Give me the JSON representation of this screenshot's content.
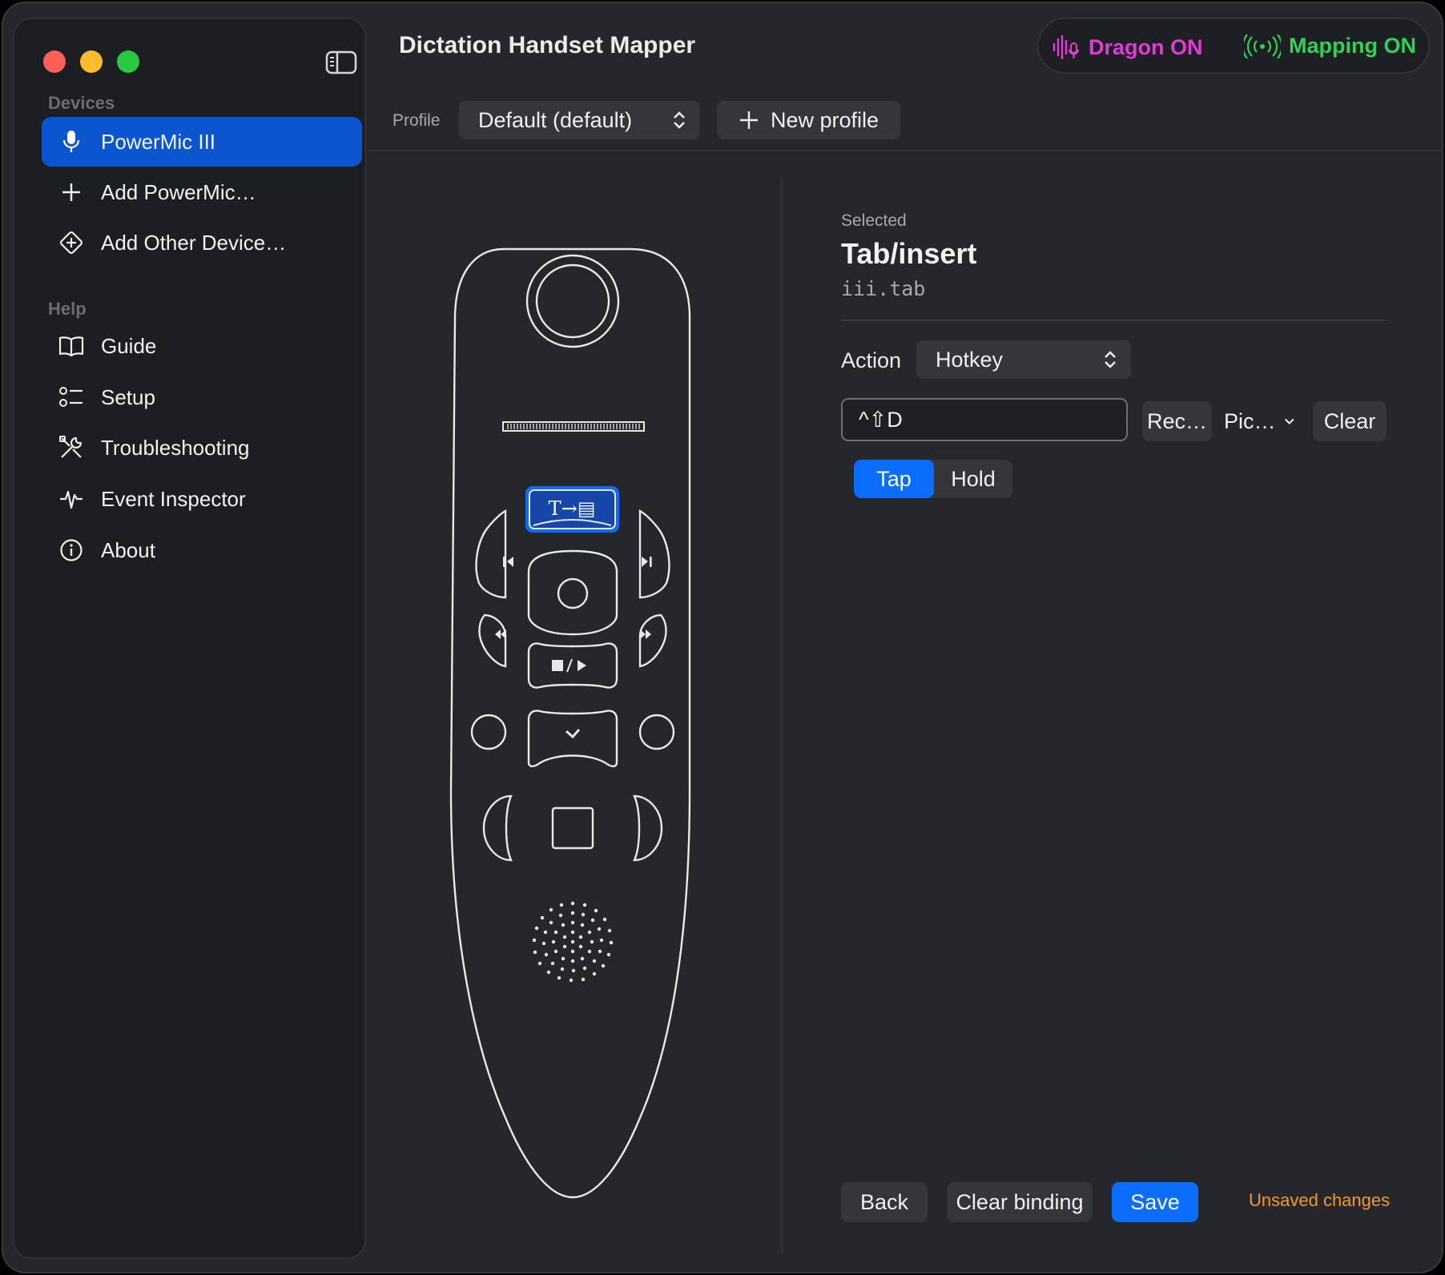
{
  "window": {
    "title": "Dictation Handset Mapper",
    "traffic_lights": [
      "close",
      "minimize",
      "zoom"
    ]
  },
  "sidebar": {
    "toggle_icon": "sidebar-toggle-icon",
    "sections": [
      {
        "label": "Devices",
        "items": [
          {
            "label": "PowerMic III",
            "icon": "microphone-icon",
            "active": true
          },
          {
            "label": "Add PowerMic…",
            "icon": "plus-icon",
            "active": false
          },
          {
            "label": "Add Other Device…",
            "icon": "diamond-plus-icon",
            "active": false
          }
        ]
      },
      {
        "label": "Help",
        "items": [
          {
            "label": "Guide",
            "icon": "book-icon"
          },
          {
            "label": "Setup",
            "icon": "checklist-icon"
          },
          {
            "label": "Troubleshooting",
            "icon": "tools-icon"
          },
          {
            "label": "Event Inspector",
            "icon": "waveform-icon"
          },
          {
            "label": "About",
            "icon": "info-icon"
          }
        ]
      }
    ]
  },
  "header": {
    "status": {
      "dragon": {
        "label": "Dragon ON",
        "icon": "waveform-mic-icon",
        "color": "#e23ad9"
      },
      "mapping": {
        "label": "Mapping ON",
        "icon": "broadcast-icon",
        "color": "#31d158"
      }
    },
    "profile_label": "Profile",
    "profile_value": "Default (default)",
    "new_profile_label": "New profile"
  },
  "device": {
    "highlighted_button": "Tab/insert",
    "highlighted_glyph": "T→▤",
    "play_stop_glyph": "■ / ▶"
  },
  "panel": {
    "selected_label": "Selected",
    "selected_title": "Tab/insert",
    "selected_id": "iii.tab",
    "action_label": "Action",
    "action_value": "Hotkey",
    "hotkey_value": "^⇧D",
    "record_label": "Rec…",
    "pick_label": "Pic…",
    "clear_label": "Clear",
    "mode_options": [
      "Tap",
      "Hold"
    ],
    "mode_selected": "Tap",
    "back_label": "Back",
    "clear_binding_label": "Clear binding",
    "save_label": "Save",
    "unsaved_text": "Unsaved changes"
  },
  "colors": {
    "accent": "#0b6dff",
    "sidebar_selection": "#0c55d1",
    "warning": "#f7962c",
    "window_bg": "#25272b",
    "sidebar_bg": "#1d1e21"
  }
}
